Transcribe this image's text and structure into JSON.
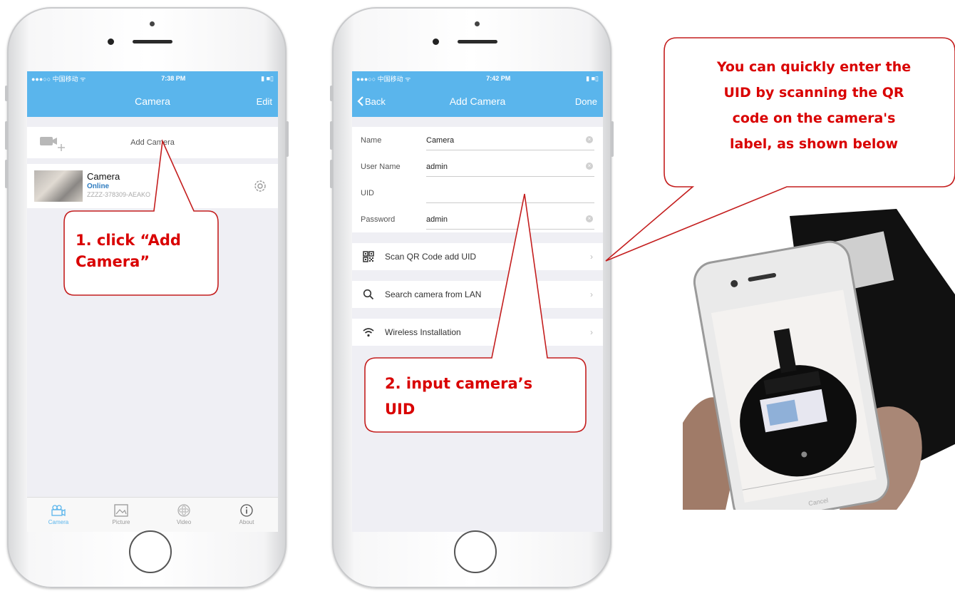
{
  "phone1": {
    "status": {
      "carrier": "●●●○○ 中国移动 ᯤ",
      "time": "7:38 PM",
      "battery": "▮ ■▯"
    },
    "nav": {
      "title": "Camera",
      "right": "Edit"
    },
    "add_camera_label": "Add Camera",
    "camera": {
      "name": "Camera",
      "status": "Online",
      "uid": "ZZZZ-378309-AEAKO"
    },
    "tabs": [
      {
        "label": "Camera",
        "icon": "camera-tab-icon"
      },
      {
        "label": "Picture",
        "icon": "picture-tab-icon"
      },
      {
        "label": "Video",
        "icon": "video-tab-icon"
      },
      {
        "label": "About",
        "icon": "about-tab-icon"
      }
    ]
  },
  "phone2": {
    "status": {
      "carrier": "●●●○○ 中国移动 ᯤ",
      "time": "7:42 PM",
      "battery": "▮ ■▯"
    },
    "nav": {
      "back": "Back",
      "title": "Add Camera",
      "right": "Done"
    },
    "fields": [
      {
        "label": "Name",
        "value": "Camera"
      },
      {
        "label": "User Name",
        "value": "admin"
      },
      {
        "label": "UID",
        "value": ""
      },
      {
        "label": "Password",
        "value": "admin"
      }
    ],
    "options": [
      {
        "label": "Scan QR Code add UID",
        "icon": "qr-code-icon"
      },
      {
        "label": "Search camera from LAN",
        "icon": "search-icon"
      },
      {
        "label": "Wireless Installation",
        "icon": "wifi-icon"
      }
    ]
  },
  "callouts": {
    "step1_line1": "1. click “Add",
    "step1_line2": "Camera”",
    "step2_line1": "2. input camera’s",
    "step2_line2": "UID",
    "qr_line1": "You can quickly enter the",
    "qr_line2": "UID by scanning the QR",
    "qr_line3": "code on the camera's",
    "qr_line4": "label, as shown below"
  },
  "photo": {
    "cancel_label": "Cancel"
  },
  "colors": {
    "accent": "#5ab5ec",
    "callout": "#d90000"
  }
}
